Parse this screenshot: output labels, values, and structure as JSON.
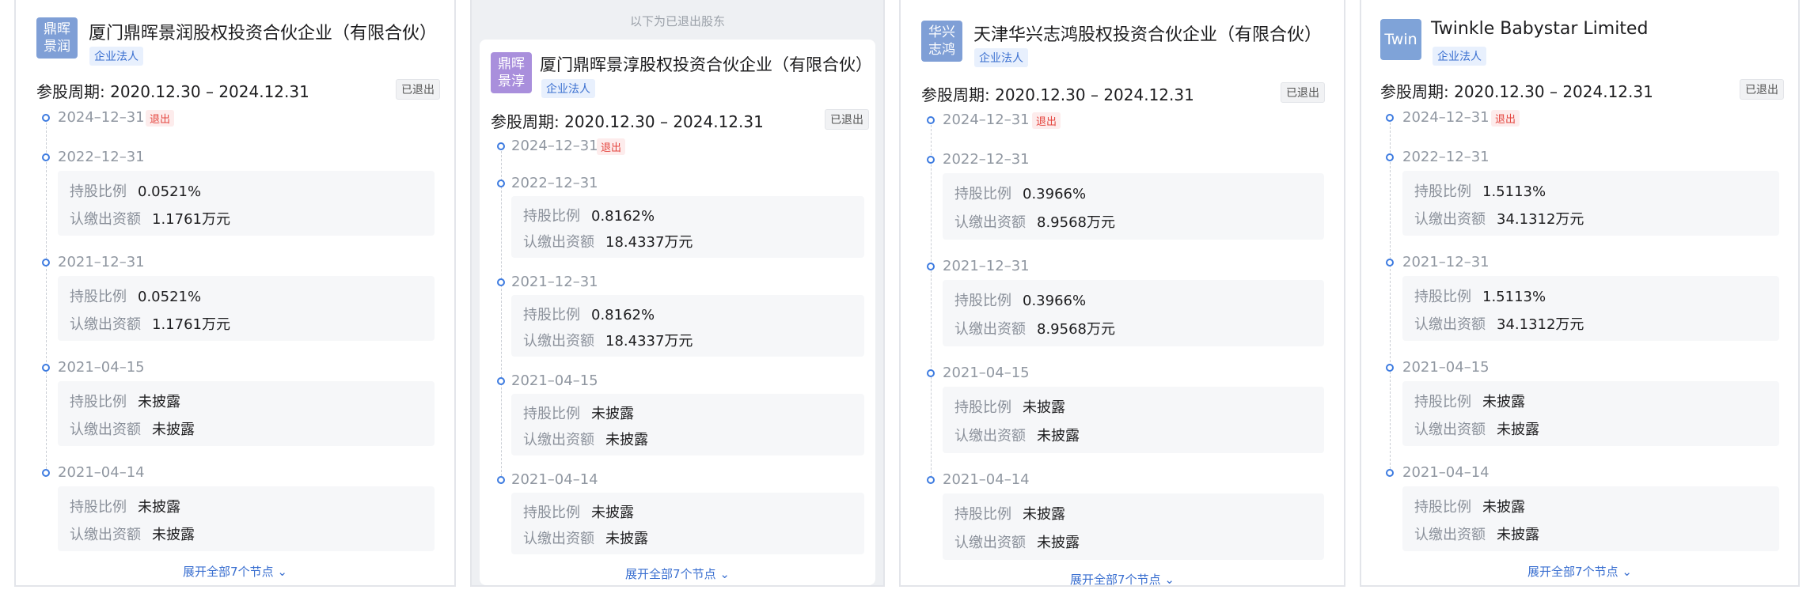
{
  "labels": {
    "ratio": "持股比例",
    "capital": "认缴出资额",
    "exited_badge": "退出",
    "exited_status": "已退出",
    "legal_person_tag": "企业法人",
    "exited_shareholders_note": "以下为已退出股东",
    "expand": "展开全部7个节点"
  },
  "colors": {
    "avatar_blue": "#7f9fd6",
    "avatar_purple": "#a98fdc",
    "avatar_twin": "#7fa3d8",
    "accent": "#3d7be0",
    "exit_red": "#e4453e"
  },
  "panels": [
    {
      "avatar_text": "鼎晖景润",
      "name": "厦门鼎晖景润股权投资合伙企业（有限合伙）",
      "period": "参股周期: 2020.12.30 – 2024.12.31",
      "nodes": [
        {
          "date": "2024–12–31",
          "exited": true
        },
        {
          "date": "2022–12–31",
          "ratio": "0.0521%",
          "capital": "1.1761万元"
        },
        {
          "date": "2021–12–31",
          "ratio": "0.0521%",
          "capital": "1.1761万元"
        },
        {
          "date": "2021–04–15",
          "ratio": "未披露",
          "capital": "未披露"
        },
        {
          "date": "2021–04–14",
          "ratio": "未披露",
          "capital": "未披露"
        }
      ]
    },
    {
      "avatar_text": "鼎晖景淳",
      "name": "厦门鼎晖景淳股权投资合伙企业（有限合伙）",
      "period": "参股周期: 2020.12.30 – 2024.12.31",
      "nodes": [
        {
          "date": "2024–12–31",
          "exited": true
        },
        {
          "date": "2022–12–31",
          "ratio": "0.8162%",
          "capital": "18.4337万元"
        },
        {
          "date": "2021–12–31",
          "ratio": "0.8162%",
          "capital": "18.4337万元"
        },
        {
          "date": "2021–04–15",
          "ratio": "未披露",
          "capital": "未披露"
        },
        {
          "date": "2021–04–14",
          "ratio": "未披露",
          "capital": "未披露"
        }
      ]
    },
    {
      "avatar_text": "华兴志鸿",
      "name": "天津华兴志鸿股权投资合伙企业（有限合伙）",
      "period": "参股周期: 2020.12.30 – 2024.12.31",
      "nodes": [
        {
          "date": "2024–12–31",
          "exited": true
        },
        {
          "date": "2022–12–31",
          "ratio": "0.3966%",
          "capital": "8.9568万元"
        },
        {
          "date": "2021–12–31",
          "ratio": "0.3966%",
          "capital": "8.9568万元"
        },
        {
          "date": "2021–04–15",
          "ratio": "未披露",
          "capital": "未披露"
        },
        {
          "date": "2021–04–14",
          "ratio": "未披露",
          "capital": "未披露"
        }
      ]
    },
    {
      "avatar_text": "Twin",
      "name": "Twinkle Babystar Limited",
      "period": "参股周期: 2020.12.30 – 2024.12.31",
      "nodes": [
        {
          "date": "2024–12–31",
          "exited": true
        },
        {
          "date": "2022–12–31",
          "ratio": "1.5113%",
          "capital": "34.1312万元"
        },
        {
          "date": "2021–12–31",
          "ratio": "1.5113%",
          "capital": "34.1312万元"
        },
        {
          "date": "2021–04–15",
          "ratio": "未披露",
          "capital": "未披露"
        },
        {
          "date": "2021–04–14",
          "ratio": "未披露",
          "capital": "未披露"
        }
      ]
    }
  ]
}
